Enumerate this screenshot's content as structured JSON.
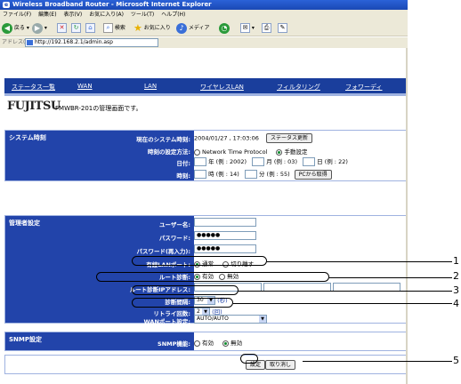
{
  "browser": {
    "title": "Wireless Broadband Router - Microsoft Internet Explorer",
    "menu": [
      "ファイル(F)",
      "編集(E)",
      "表示(V)",
      "お気に入り(A)",
      "ツール(T)",
      "ヘルプ(H)"
    ],
    "toolbar": {
      "back": "戻る",
      "search": "検索",
      "favorites": "お気に入り",
      "media": "メディア"
    },
    "address_label": "アドレス(D)",
    "address": "http://192.168.2.1/admin.asp"
  },
  "nav": [
    "ステータス一覧",
    "WAN",
    "LAN",
    "ワイヤレスLAN",
    "フィルタリング",
    "フォワーディ"
  ],
  "brand": {
    "logo": "FUJITSU",
    "description": "FMWBR-201の管理画面です。"
  },
  "system_time": {
    "section": "システム時刻",
    "current_label": "現在のシステム時刻:",
    "current_value": "2004/01/27 , 17:03:06",
    "status_button": "ステータス更新",
    "method_label": "時刻の設定方法:",
    "method_ntp": "Network Time Protocol",
    "method_manual": "手動設定",
    "date_label": "日付:",
    "year_hint": "年 (例 : 2002)",
    "month_hint": "月 (例 : 03)",
    "day_hint": "日 (例 : 22)",
    "time_label": "時刻:",
    "hour_hint": "時 (例 : 14)",
    "min_hint": "分 (例 : 55)",
    "pc_button": "PCから取得"
  },
  "admin": {
    "section": "管理者設定",
    "user_label": "ユーザー名:",
    "password_label": "パスワード:",
    "password_value": "●●●●●",
    "password_again_label": "パスワード(再入力):",
    "password_again_value": "●●●●●",
    "wired_lan_label": "有線LANポート:",
    "wired_normal": "通常",
    "wired_disconnect": "切り離す",
    "route_diag_label": "ルート診断:",
    "route_on": "有効",
    "route_off": "無効",
    "route_ip_label": "ルート診断IPアドレス:",
    "interval_label": "診断間隔:",
    "interval_value": "30",
    "interval_unit": "(秒)",
    "retry_label": "リトライ回数:",
    "retry_value": "2",
    "retry_unit": "(回)",
    "wan_port_label": "WANポート設定:",
    "wan_port_value": "AUTO/AUTO"
  },
  "snmp": {
    "section": "SNMP設定",
    "label": "SNMP機能:",
    "on": "有効",
    "off": "無効"
  },
  "buttons": {
    "apply": "設定",
    "cancel": "取り消し"
  },
  "callouts": [
    "1",
    "2",
    "3",
    "4",
    "5"
  ]
}
